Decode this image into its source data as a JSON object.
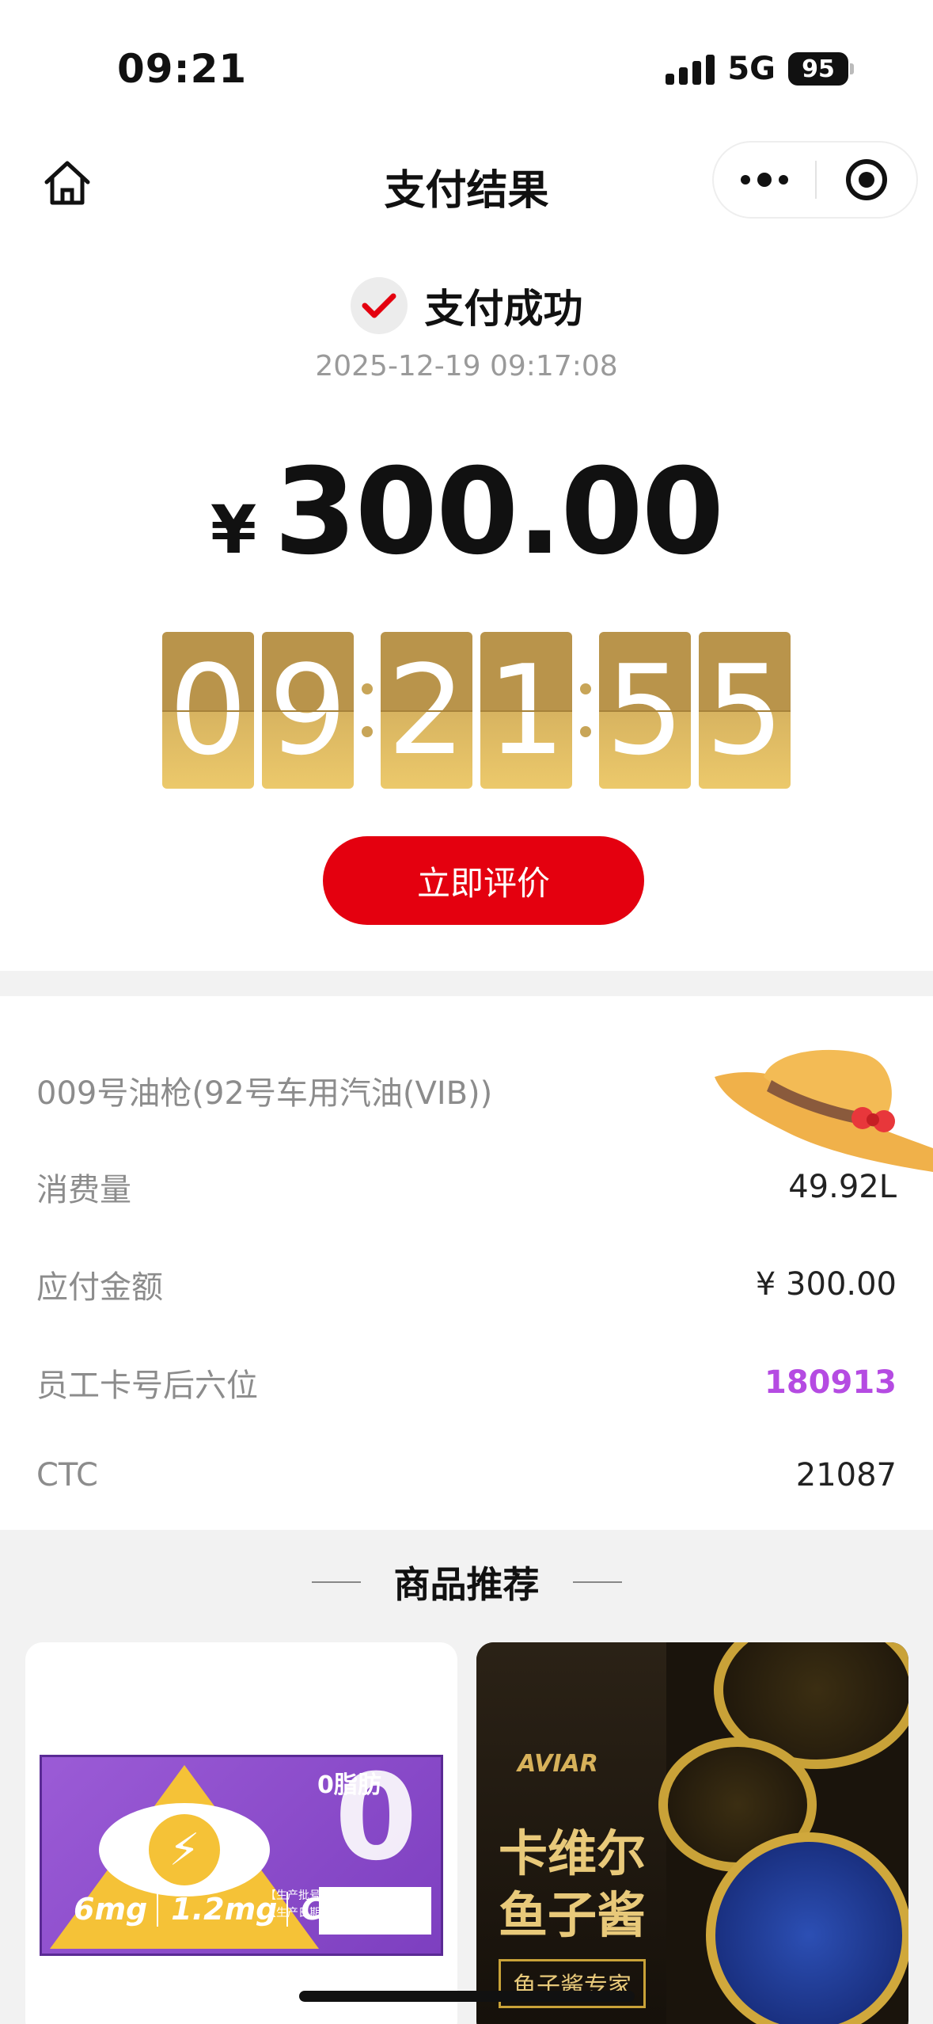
{
  "status_bar": {
    "time": "09:21",
    "network": "5G",
    "battery": "95"
  },
  "nav": {
    "title": "支付结果"
  },
  "payment": {
    "status": "支付成功",
    "datetime": "2025-12-19 09:17:08",
    "currency_symbol": "¥",
    "amount": "300.00"
  },
  "clock": {
    "digits": [
      "0",
      "9",
      "2",
      "1",
      "5",
      "5"
    ]
  },
  "rate_button": "立即评价",
  "details": {
    "pump": "009号油枪(92号车用汽油(VIB))",
    "rows": [
      {
        "label": "消费量",
        "value": "49.92L"
      },
      {
        "label": "应付金额",
        "value": "¥ 300.00"
      },
      {
        "label": "员工卡号后六位",
        "value": "180913"
      },
      {
        "label": "CTC",
        "value": "21087"
      }
    ]
  },
  "recommend": {
    "title": "商品推荐",
    "product1": {
      "zero_fat": "0脂肪",
      "nums": [
        "6mg",
        "1.2mg",
        "C"
      ],
      "tags": [
        "【生产批号】",
        "【生产日期】"
      ]
    },
    "product2": {
      "brand": "AVIAR",
      "name_line1": "卡维尔",
      "name_line2": "鱼子酱",
      "tag": "鱼子酱专家"
    }
  },
  "colors": {
    "accent_red": "#e4000f",
    "card_no_purple": "#b54be2",
    "clock_gold": "#c8a558"
  }
}
